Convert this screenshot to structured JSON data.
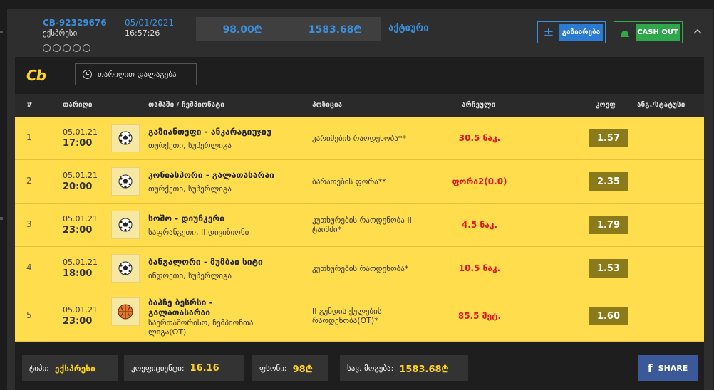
{
  "header": {
    "bet_id": "CB-92329676",
    "bet_type": "ექსპრესი",
    "date": "05/01/2021",
    "time": "16:57:26",
    "stake": "98.00₾",
    "possible_win": "1583.68₾",
    "status": "აქტიური",
    "copy_label": "გაზიარება",
    "copy_plus": "±",
    "cashout_label": "CASH OUT",
    "chevron": "^"
  },
  "panel": {
    "logo": "Cb",
    "filter_label": "თარიღით დალაგება"
  },
  "table": {
    "headers": {
      "num": "#",
      "date": "თარიღი",
      "game": "თამაში / ჩემპიონატი",
      "position": "პოზიცია",
      "pick": "არჩეული",
      "odd": "კოეფ",
      "result": "ანგ./სტატუსი"
    },
    "rows": [
      {
        "num": "1",
        "date": "05.01.21",
        "time": "17:00",
        "sport": "football",
        "game": "გაზიანთეფი - ანკარაგიუჯიუ",
        "league": "თურქეთი, სუპერლიგა",
        "position": "კარიმების რაოდენობა**",
        "pick": "30.5 ნაკ.",
        "odd": "1.57"
      },
      {
        "num": "2",
        "date": "05.01.21",
        "time": "20:00",
        "sport": "football",
        "game": "კონიასპორი - გალათასარაი",
        "league": "თურქეთი, სუპერლიგა",
        "position": "ბარათების ფორა**",
        "pick": "ფორა2(0.0)",
        "odd": "2.35"
      },
      {
        "num": "3",
        "date": "05.01.21",
        "time": "23:00",
        "sport": "football",
        "game": "სოშო - დიუნკერი",
        "league": "საფრანგეთი, II დივიზიონი",
        "position": "კუთხურების რაოდენობა II ტაიმში*",
        "pick": "4.5 ნაკ.",
        "odd": "1.79"
      },
      {
        "num": "4",
        "date": "05.01.21",
        "time": "18:00",
        "sport": "football",
        "game": "ბანგალორი - მუმბაი სიტი",
        "league": "ინდოეთი, სუპერლიგა",
        "position": "კუთხურების რაოდენობა*",
        "pick": "10.5 ნაკ.",
        "odd": "1.53"
      },
      {
        "num": "5",
        "date": "05.01.21",
        "time": "23:00",
        "sport": "basketball",
        "game": "ბაჰჩე ბესრსი - გალათასარაი",
        "league": "საერთაშორისო, ჩემპიონთა ლიგა(OT)",
        "position": "II გუნდის ქულების რაოდენობა(OT)*",
        "pick": "85.5 მეტ.",
        "odd": "1.60"
      }
    ]
  },
  "footer": {
    "type_label": "ტიპი:",
    "type_value": "ექსპრესი",
    "coef_label": "კოეფიციენტი:",
    "coef_value": "16.16",
    "stake_label": "ფსონი:",
    "stake_value": "98₾",
    "win_label": "სავ. მოგება:",
    "win_value": "1583.68₾",
    "share_label": "SHARE",
    "share_icon": "f"
  },
  "colors": {
    "accent_blue": "#3d8fdd",
    "row_yellow": "#ffdd4c",
    "odd_bg": "#8b7a1a",
    "pick_red": "#e0141e",
    "cash_green": "#2ea84a",
    "fb_blue": "#3b5998",
    "logo_yellow": "#ffd41f"
  }
}
